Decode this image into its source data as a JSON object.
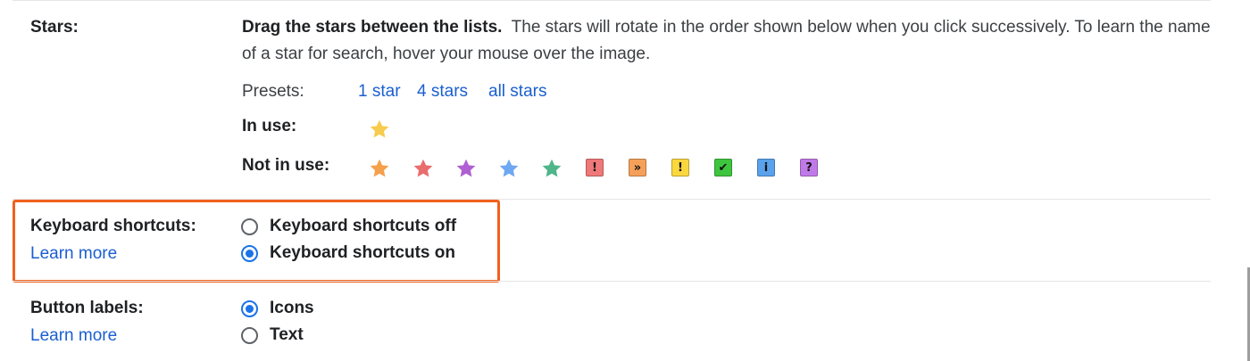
{
  "stars": {
    "label": "Stars:",
    "desc_bold": "Drag the stars between the lists.",
    "desc_rest": "The stars will rotate in the order shown below when you click successively. To learn the name of a star for search, hover your mouse over the image.",
    "presets_label": "Presets:",
    "presets": [
      "1 star",
      "4 stars",
      "all stars"
    ],
    "in_use_label": "In use:",
    "in_use": [
      {
        "icon": "yellow-star-icon",
        "color": "#f7cb4d"
      }
    ],
    "not_in_use_label": "Not in use:",
    "not_in_use": [
      {
        "icon": "orange-star-icon",
        "kind": "star",
        "color": "#f4a04c"
      },
      {
        "icon": "red-star-icon",
        "kind": "star",
        "color": "#e96d6d"
      },
      {
        "icon": "purple-star-icon",
        "kind": "star",
        "color": "#b05fd3"
      },
      {
        "icon": "blue-star-icon",
        "kind": "star",
        "color": "#6fa8f2"
      },
      {
        "icon": "green-star-icon",
        "kind": "star",
        "color": "#4fb58a"
      },
      {
        "icon": "red-bang-icon",
        "kind": "box",
        "color": "#f07878",
        "glyph": "!"
      },
      {
        "icon": "orange-guillemet-icon",
        "kind": "box",
        "color": "#f5a05a",
        "glyph": "»"
      },
      {
        "icon": "yellow-bang-icon",
        "kind": "box",
        "color": "#fad73e",
        "glyph": "!"
      },
      {
        "icon": "green-check-icon",
        "kind": "box",
        "color": "#3ec53e",
        "glyph": "✔"
      },
      {
        "icon": "blue-info-icon",
        "kind": "box",
        "color": "#5aa2ec",
        "glyph": "i"
      },
      {
        "icon": "purple-question-icon",
        "kind": "box",
        "color": "#c07ae8",
        "glyph": "?"
      }
    ]
  },
  "keyboard": {
    "label": "Keyboard shortcuts:",
    "learn_more": "Learn more",
    "options": [
      {
        "label": "Keyboard shortcuts off",
        "selected": false
      },
      {
        "label": "Keyboard shortcuts on",
        "selected": true
      }
    ],
    "highlight_color": "#f0611e"
  },
  "buttons": {
    "label": "Button labels:",
    "learn_more": "Learn more",
    "options": [
      {
        "label": "Icons",
        "selected": true
      },
      {
        "label": "Text",
        "selected": false
      }
    ]
  },
  "colors": {
    "link": "#1a5fd0",
    "radio_accent": "#1a73e8"
  }
}
